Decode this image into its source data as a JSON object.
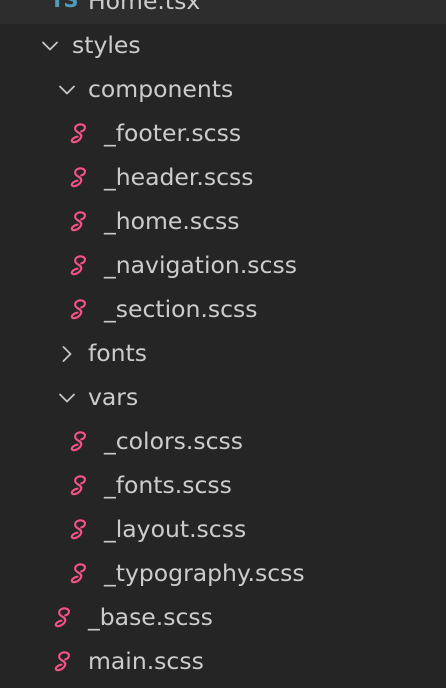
{
  "explorer": {
    "accent_colors": {
      "background": "#252526",
      "text": "#cccccc",
      "chevron": "#c5c5c5",
      "sass_icon": "#f55385",
      "ts_icon": "#519aba"
    },
    "items": [
      {
        "label": "Home.tsx",
        "kind": "file",
        "icon": "typescript-icon",
        "icon_text": "TS"
      },
      {
        "label": "styles",
        "kind": "folder",
        "expanded": true
      },
      {
        "label": "components",
        "kind": "folder",
        "expanded": true
      },
      {
        "label": "_footer.scss",
        "kind": "file",
        "icon": "sass-icon"
      },
      {
        "label": "_header.scss",
        "kind": "file",
        "icon": "sass-icon"
      },
      {
        "label": "_home.scss",
        "kind": "file",
        "icon": "sass-icon"
      },
      {
        "label": "_navigation.scss",
        "kind": "file",
        "icon": "sass-icon"
      },
      {
        "label": "_section.scss",
        "kind": "file",
        "icon": "sass-icon"
      },
      {
        "label": "fonts",
        "kind": "folder",
        "expanded": false
      },
      {
        "label": "vars",
        "kind": "folder",
        "expanded": true
      },
      {
        "label": "_colors.scss",
        "kind": "file",
        "icon": "sass-icon"
      },
      {
        "label": "_fonts.scss",
        "kind": "file",
        "icon": "sass-icon"
      },
      {
        "label": "_layout.scss",
        "kind": "file",
        "icon": "sass-icon"
      },
      {
        "label": "_typography.scss",
        "kind": "file",
        "icon": "sass-icon"
      },
      {
        "label": "_base.scss",
        "kind": "file",
        "icon": "sass-icon"
      },
      {
        "label": "main.scss",
        "kind": "file",
        "icon": "sass-icon"
      }
    ]
  }
}
